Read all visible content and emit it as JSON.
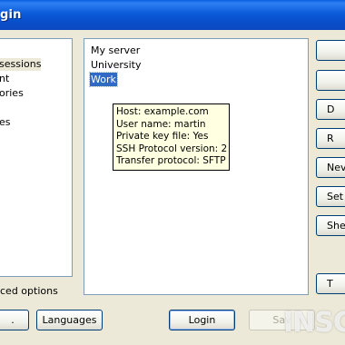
{
  "window": {
    "title": "gin"
  },
  "nav": {
    "items": [
      {
        "label": "sessions",
        "selected": true
      },
      {
        "label": "nt",
        "selected": false
      },
      {
        "label": "ories",
        "selected": false
      },
      {
        "label": "es",
        "selected": false
      }
    ],
    "advanced_options_label": "ced options"
  },
  "sessions": {
    "items": [
      {
        "label": "My server",
        "selected": false
      },
      {
        "label": "University",
        "selected": false
      },
      {
        "label": "Work",
        "selected": true
      }
    ]
  },
  "tooltip": {
    "lines": [
      "Host: example.com",
      "User name: martin",
      "Private key file: Yes",
      "SSH Protocol version: 2",
      "Transfer protocol: SFTP"
    ]
  },
  "right_buttons": [
    "",
    "",
    "D",
    "R",
    "Nev",
    "Set",
    "She",
    "T"
  ],
  "bottom_buttons": {
    "partial": ".",
    "languages": "Languages",
    "login": "Login",
    "save": "Sav"
  },
  "watermark": "INSC"
}
